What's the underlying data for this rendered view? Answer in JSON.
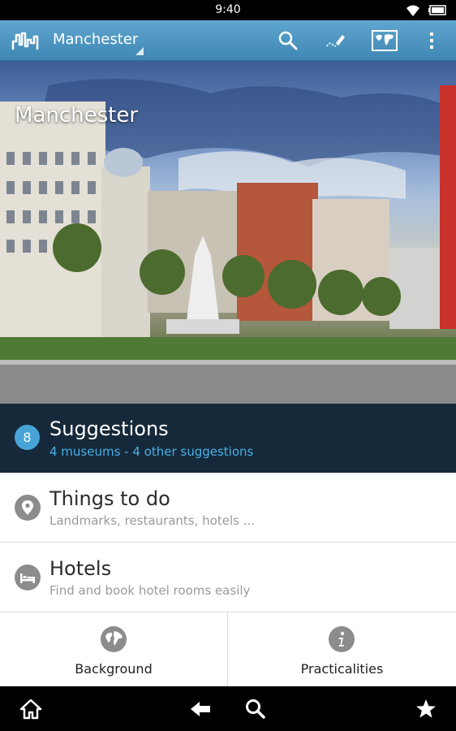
{
  "status_bar": {
    "time": "9:40"
  },
  "action_bar": {
    "title": "Manchester",
    "icons": [
      "search-icon",
      "edit-icon",
      "map-icon",
      "overflow-menu-icon"
    ]
  },
  "hero": {
    "title": "Manchester"
  },
  "suggestions": {
    "count": "8",
    "title": "Suggestions",
    "subtitle": "4 museums - 4 other suggestions"
  },
  "things_to_do": {
    "title": "Things to do",
    "subtitle": "Landmarks, restaurants, hotels ..."
  },
  "hotels": {
    "title": "Hotels",
    "subtitle": "Find and book hotel rooms easily"
  },
  "tiles": {
    "background_label": "Background",
    "practicalities_label": "Practicalities"
  },
  "colors": {
    "action_bar": "#4b95c2",
    "suggestions_bg": "#15293a",
    "accent": "#48a4d6",
    "icon_gray": "#8c8c8c"
  }
}
